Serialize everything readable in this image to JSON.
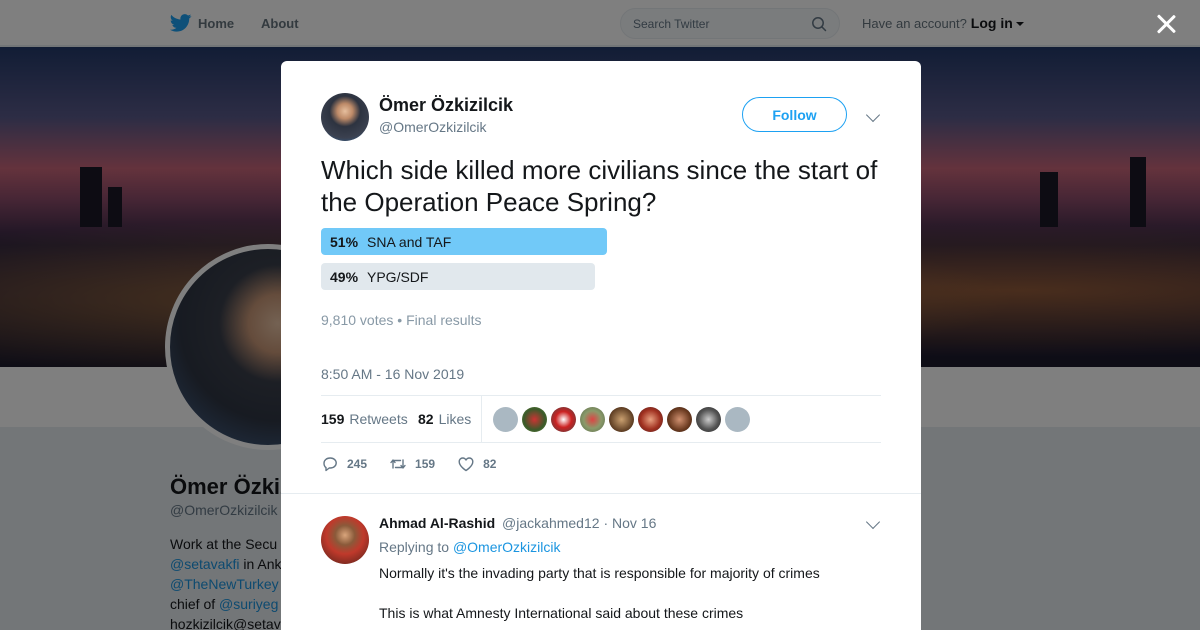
{
  "topbar": {
    "home_label": "Home",
    "about_label": "About",
    "search_placeholder": "Search Twitter",
    "account_prompt": "Have an account?",
    "login_label": "Log in"
  },
  "profile": {
    "name": "Ömer Özkizilc",
    "handle": "@OmerOzkizilcik",
    "bio_lines": [
      {
        "text": "Work at the Secu",
        "link": ""
      },
      {
        "text": " in Ank",
        "link": "@setavakfi"
      },
      {
        "text": "",
        "link": "@TheNewTurkey"
      },
      {
        "text": "chief of ",
        "link": "@suriyeg"
      },
      {
        "text": "hozkizilcik@setav",
        "link": ""
      }
    ]
  },
  "tweet": {
    "author_name": "Ömer Özkizilcik",
    "author_handle": "@OmerOzkizilcik",
    "follow_label": "Follow",
    "text": "Which side killed more civilians since the start of the Operation Peace Spring?",
    "poll": {
      "options": [
        {
          "percent": "51%",
          "label": "SNA and TAF",
          "fraction": 0.51
        },
        {
          "percent": "49%",
          "label": "YPG/SDF",
          "fraction": 0.49
        }
      ],
      "votes": "9,810 votes",
      "separator": "•",
      "status": "Final results"
    },
    "timestamp": "8:50 AM - 16 Nov 2019",
    "retweets_count": "159",
    "retweets_label": "Retweets",
    "likes_count": "82",
    "likes_label": "Likes",
    "actions": {
      "replies": "245",
      "retweets": "159",
      "likes": "82"
    }
  },
  "reply": {
    "name": "Ahmad Al-Rashid",
    "handle": "@jackahmed12",
    "separator": "·",
    "date": "Nov 16",
    "replying_prefix": "Replying to",
    "replying_to": "@OmerOzkizilcik",
    "paragraphs": [
      "Normally it's the invading party that is responsible for majority of  crimes",
      "This is what Amnesty International said about these crimes"
    ]
  },
  "colors": {
    "accent": "#1da1f2",
    "poll_winner": "#71c9f8",
    "poll_other": "#e1e8ed",
    "link": "#1b95e0"
  }
}
